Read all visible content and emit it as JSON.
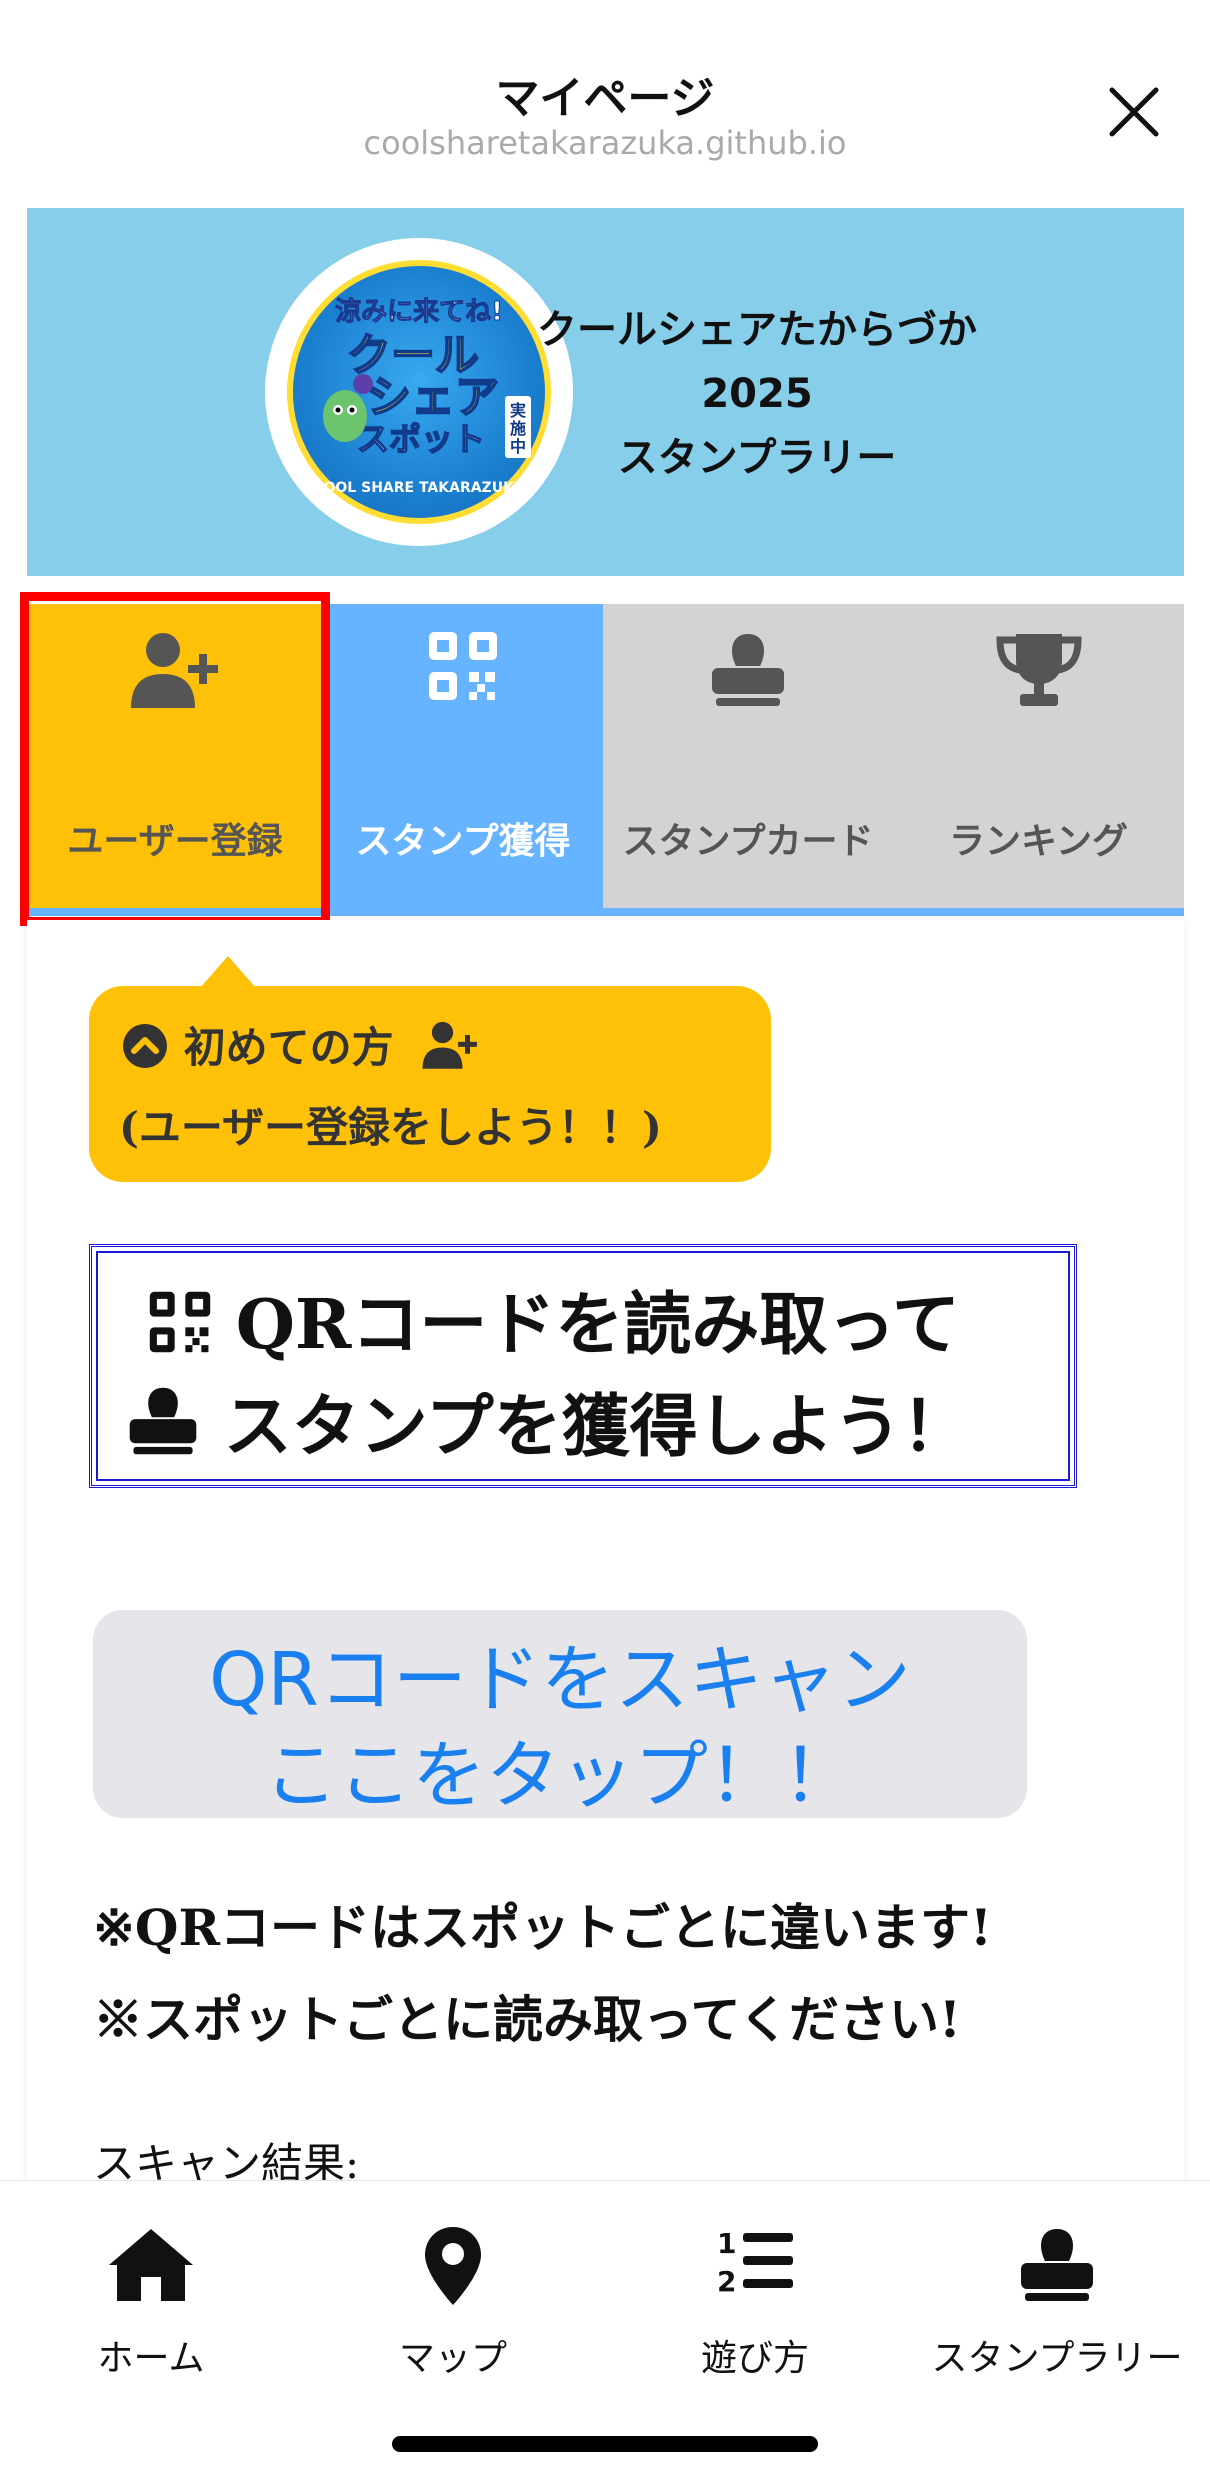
{
  "header": {
    "title": "マイページ",
    "url": "coolsharetakarazuka.github.io",
    "close_icon": "close-icon"
  },
  "banner": {
    "logo_text": "涼みに来てね! クールシェアスポット 実施中 COOL SHARE TAKARAZUKA",
    "title_line1": "クールシェアたからづか",
    "title_line2": "2025",
    "title_line3": "スタンプラリー",
    "background_color": "#87ceeb"
  },
  "tabs": [
    {
      "label": "ユーザー登録",
      "icon": "user-plus-icon",
      "active": true,
      "color": "#ffc107"
    },
    {
      "label": "スタンプ獲得",
      "icon": "qrcode-icon",
      "active": false,
      "color": "#66b3ff"
    },
    {
      "label": "スタンプカード",
      "icon": "stamp-icon",
      "active": false,
      "color": "#d3d3d3"
    },
    {
      "label": "ランキング",
      "icon": "trophy-icon",
      "active": false,
      "color": "#d3d3d3"
    }
  ],
  "tip": {
    "line1": "初めての方",
    "line2": "(ユーザー登録をしよう！！)",
    "color": "#ffc107"
  },
  "instruction": {
    "line1": "QRコードを読み取って",
    "line2": "スタンプを獲得しよう！"
  },
  "scan_button": {
    "line1": "QRコードをスキャン",
    "line2": "ここをタップ！！",
    "text_color": "#1a80f0"
  },
  "notes": {
    "line1": "※QRコードはスポットごとに違います!",
    "line2": "※スポットごとに読み取ってください!"
  },
  "scan_result_label": "スキャン結果:",
  "bottom_nav": [
    {
      "label": "ホーム",
      "icon": "home-icon"
    },
    {
      "label": "マップ",
      "icon": "map-pin-icon"
    },
    {
      "label": "遊び方",
      "icon": "numbered-list-icon"
    },
    {
      "label": "スタンプラリー",
      "icon": "stamp-icon"
    }
  ]
}
